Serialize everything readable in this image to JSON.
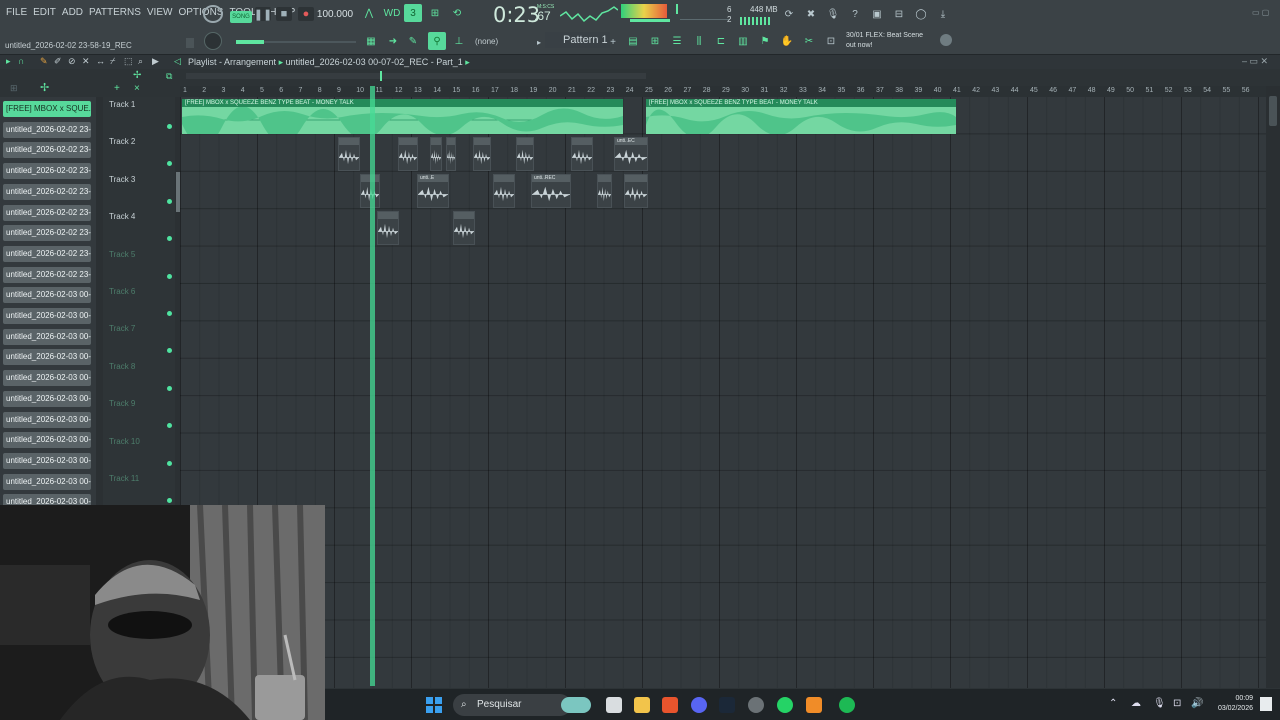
{
  "menu": [
    "FILE",
    "EDIT",
    "ADD",
    "PATTERNS",
    "VIEW",
    "OPTIONS",
    "TOOLS",
    "HELP"
  ],
  "project_name": "untitled_2026-02-02 23-58-19_REC",
  "song_mode_label": "SONG",
  "tempo": "100.000",
  "time_display": "0:23",
  "time_sub": ":67",
  "time_unit": "M:S:CS",
  "memory": "448 MB",
  "cpu_value": "6",
  "poly_value": "2",
  "snap": "(none)",
  "pattern": "Pattern 1",
  "hint": {
    "line1": "30/01  FLEX: Beat Scene",
    "line2": "out now!"
  },
  "playlist": {
    "breadcrumb": "Playlist - Arrangement",
    "arrangement": "untitled_2026-02-03 00-07-02_REC - Part_1"
  },
  "browser": [
    "[FREE] MBOX x SQUE...",
    "untitled_2026-02-02 23-...",
    "untitled_2026-02-02 23-...",
    "untitled_2026-02-02 23-...",
    "untitled_2026-02-02 23-...",
    "untitled_2026-02-02 23-...",
    "untitled_2026-02-02 23-...",
    "untitled_2026-02-02 23-...",
    "untitled_2026-02-02 23-...",
    "untitled_2026-02-03 00-...",
    "untitled_2026-02-03 00-...",
    "untitled_2026-02-03 00-...",
    "untitled_2026-02-03 00-...",
    "untitled_2026-02-03 00-...",
    "untitled_2026-02-03 00-...",
    "untitled_2026-02-03 00-...",
    "untitled_2026-02-03 00-...",
    "untitled_2026-02-03 00-...",
    "untitled_2026-02-03 00-...",
    "untitled_2026-02-03 00-..."
  ],
  "tracks": [
    "Track 1",
    "Track 2",
    "Track 3",
    "Track 4",
    "Track 5",
    "Track 6",
    "Track 7",
    "Track 8",
    "Track 9",
    "Track 10",
    "Track 11"
  ],
  "ruler": [
    1,
    2,
    3,
    4,
    5,
    6,
    7,
    8,
    9,
    10,
    11,
    12,
    13,
    14,
    15,
    16,
    17,
    18,
    19,
    20,
    21,
    22,
    23,
    24,
    25,
    26,
    27,
    28,
    29,
    30,
    31,
    32,
    33,
    34,
    35,
    36,
    37,
    38,
    39,
    40,
    41,
    42,
    43,
    44,
    45,
    46,
    47,
    48,
    49,
    50,
    51,
    52,
    53,
    54,
    55,
    56
  ],
  "clips": {
    "beat_title": "[FREE] MBOX x SQUEEZE BENZ TYPE BEAT - MONEY TALK",
    "small_label_a": "unti..EC",
    "small_label_b": "unti..E",
    "small_label_c": "unti..REC"
  },
  "taskbar": {
    "search": "Pesquisar",
    "time": "00:09",
    "date": "03/02/2026"
  },
  "colors": {
    "accent": "#57d99b",
    "audio_clip": "#74d7a2",
    "clip_header": "#258a5a"
  }
}
